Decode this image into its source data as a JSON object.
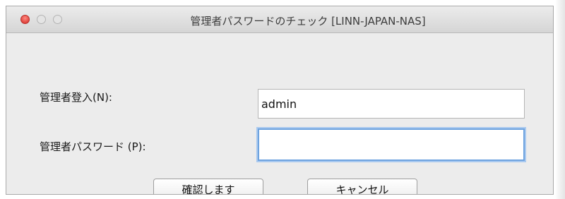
{
  "window": {
    "title": "管理者パスワードのチェック [LINN-JAPAN-NAS]",
    "buttons": [
      "close",
      "minimize",
      "zoom"
    ]
  },
  "form": {
    "username": {
      "label": "管理者登入(N):",
      "value": "admin"
    },
    "password": {
      "label": "管理者パスワード (P):",
      "value": "",
      "focused": true
    }
  },
  "actions": {
    "ok_label": "確認します",
    "cancel_label": "キャンセル"
  },
  "colors": {
    "close_button": "#e0443e",
    "focus_ring": "#6ea3df",
    "window_bg": "#ececec"
  }
}
